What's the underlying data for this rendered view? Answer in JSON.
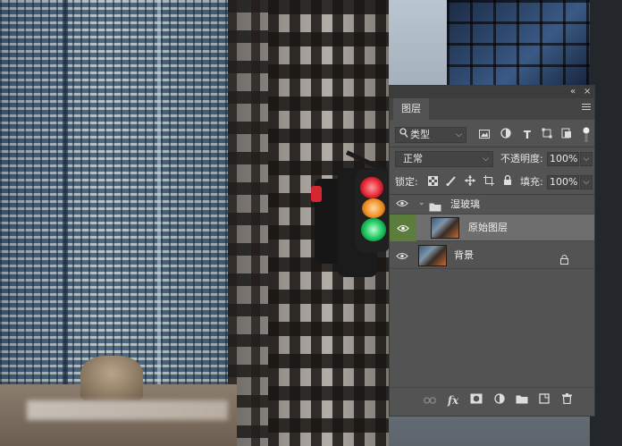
{
  "panel": {
    "tab_label": "图层",
    "collapse_glyph": "«",
    "close_glyph": "×",
    "filter": {
      "icon": "search-icon",
      "value": "类型"
    },
    "blend_mode": "正常",
    "opacity_label": "不透明度:",
    "opacity_value": "100%",
    "lock_label": "锁定:",
    "fill_label": "填充:",
    "fill_value": "100%",
    "layers": [
      {
        "name": "湿玻璃",
        "type": "group",
        "visible": true,
        "expanded": true
      },
      {
        "name": "原始图层",
        "type": "layer",
        "visible": true,
        "selected": true
      },
      {
        "name": "背景",
        "type": "layer",
        "visible": true,
        "locked": true
      }
    ],
    "bottom_icons": [
      "link-icon",
      "fx-icon",
      "mask-icon",
      "adjustment-icon",
      "folder-icon",
      "new-layer-icon",
      "trash-icon"
    ],
    "fx_label": "fx"
  }
}
